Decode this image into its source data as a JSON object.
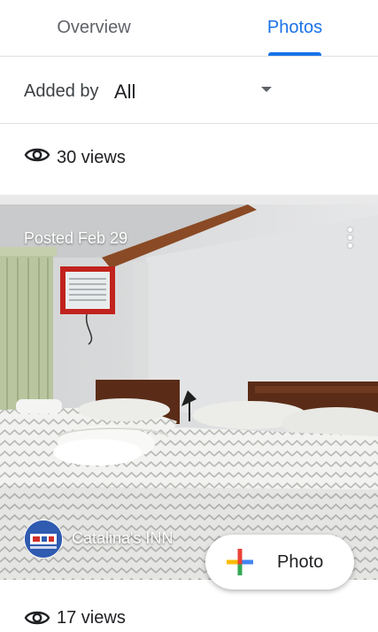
{
  "tabs": [
    {
      "label": "Overview",
      "selected": false
    },
    {
      "label": "Photos",
      "selected": true
    }
  ],
  "filter": {
    "label": "Added by",
    "value": "All"
  },
  "first_views": {
    "text": "30 views",
    "icon": "eye-icon"
  },
  "photo": {
    "posted": "Posted Feb 29",
    "author": "Catalina's INN",
    "more_icon": "more-vert-icon"
  },
  "fab": {
    "label": "Photo",
    "icon": "google-plus-icon"
  },
  "second_views": {
    "text": "17 views",
    "icon": "eye-icon"
  },
  "colors": {
    "accent": "#1a73e8",
    "text": "#202124",
    "secondary_text": "#5f6368",
    "divider": "#e0e0e0"
  }
}
